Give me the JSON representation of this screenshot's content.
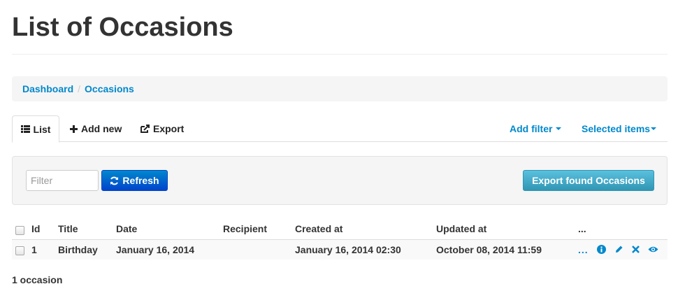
{
  "page": {
    "title": "List of Occasions"
  },
  "breadcrumb": {
    "items": [
      "Dashboard",
      "Occasions"
    ],
    "separator": "/"
  },
  "tabs": {
    "list": "List",
    "add_new": "Add new",
    "export": "Export",
    "add_filter": "Add filter",
    "selected_items": "Selected items"
  },
  "filter": {
    "placeholder": "Filter",
    "value": ""
  },
  "buttons": {
    "refresh": "Refresh",
    "export_found": "Export found Occasions"
  },
  "table": {
    "headers": {
      "id": "Id",
      "title": "Title",
      "date": "Date",
      "recipient": "Recipient",
      "created_at": "Created at",
      "updated_at": "Updated at",
      "actions": "..."
    },
    "rows": [
      {
        "id": "1",
        "title": "Birthday",
        "date": "January 16, 2014",
        "recipient": "",
        "created_at": "January 16, 2014 02:30",
        "updated_at": "October 08, 2014 11:59",
        "more": "..."
      }
    ]
  },
  "row_action_icons": [
    "info-icon",
    "pencil-icon",
    "close-icon",
    "eye-icon"
  ],
  "summary": {
    "count": "1 occasion"
  },
  "colors": {
    "link": "#0088cc",
    "refresh_btn": "#0044cc",
    "export_btn": "#49afcd"
  }
}
